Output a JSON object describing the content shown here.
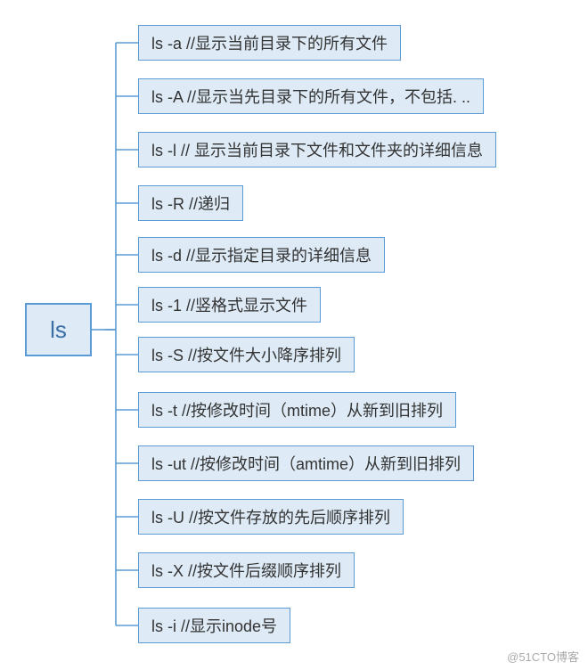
{
  "chart_data": {
    "type": "tree",
    "root": "ls",
    "children": [
      "ls -a //显示当前目录下的所有文件",
      "ls -A //显示当先目录下的所有文件，不包括. ..",
      "ls -l // 显示当前目录下文件和文件夹的详细信息",
      "ls -R //递归",
      "ls -d //显示指定目录的详细信息",
      "ls -1 //竖格式显示文件",
      "ls -S //按文件大小降序排列",
      "ls -t //按修改时间（mtime）从新到旧排列",
      "ls -ut //按修改时间（amtime）从新到旧排列",
      "ls -U //按文件存放的先后顺序排列",
      "ls -X //按文件后缀顺序排列",
      "ls -i //显示inode号"
    ]
  },
  "root": {
    "label": "ls"
  },
  "items": [
    {
      "label": "ls -a //显示当前目录下的所有文件"
    },
    {
      "label": "ls -A //显示当先目录下的所有文件，不包括. .."
    },
    {
      "label": "ls -l // 显示当前目录下文件和文件夹的详细信息"
    },
    {
      "label": "ls -R //递归"
    },
    {
      "label": "ls -d //显示指定目录的详细信息"
    },
    {
      "label": "ls -1 //竖格式显示文件"
    },
    {
      "label": "ls -S //按文件大小降序排列"
    },
    {
      "label": "ls -t //按修改时间（mtime）从新到旧排列"
    },
    {
      "label": "ls -ut //按修改时间（amtime）从新到旧排列"
    },
    {
      "label": "ls -U //按文件存放的先后顺序排列"
    },
    {
      "label": "ls -X //按文件后缀顺序排列"
    },
    {
      "label": "ls -i //显示inode号"
    }
  ],
  "watermark": "@51CTO博客",
  "colors": {
    "node_border": "#5b9bd5",
    "node_fill": "#deebf7",
    "connector": "#5b9bd5"
  }
}
